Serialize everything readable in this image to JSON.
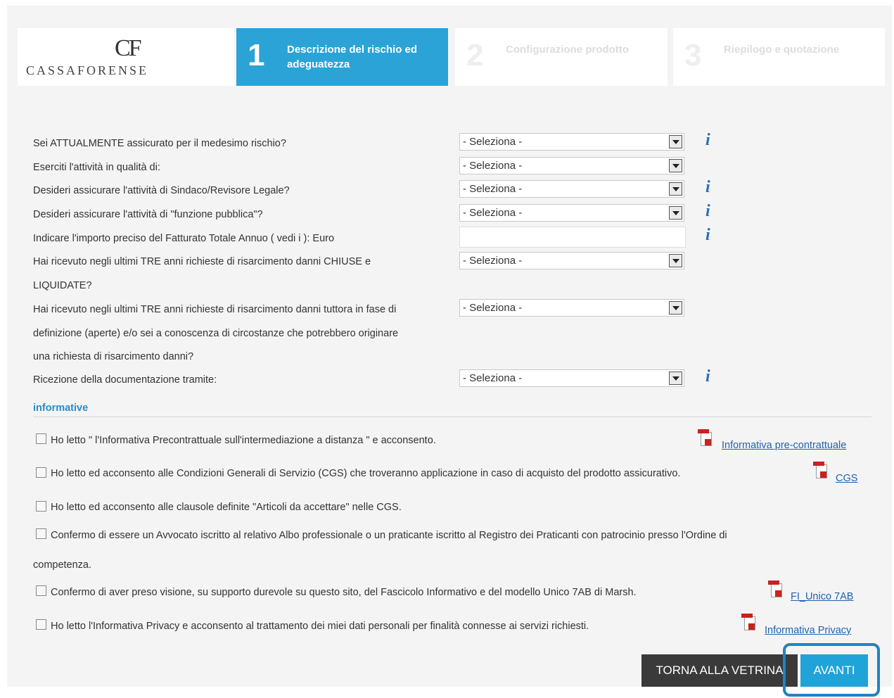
{
  "header": {
    "logo_mark": "CF",
    "logo_text": "CASSAFORENSE",
    "steps": [
      {
        "number": "1",
        "label": "Descrizione del rischio ed adeguatezza",
        "active": true
      },
      {
        "number": "2",
        "label": "Configurazione prodotto",
        "active": false
      },
      {
        "number": "3",
        "label": "Riepilogo e quotazione",
        "active": false
      }
    ]
  },
  "form": {
    "questions": [
      {
        "label": "Sei ATTUALMENTE assicurato per il medesimo rischio?",
        "value": "- Seleziona -",
        "info": true
      },
      {
        "label": "Eserciti l'attività in qualità di:",
        "value": "- Seleziona -",
        "info": false
      },
      {
        "label": "Desideri assicurare l'attività di Sindaco/Revisore Legale?",
        "value": "- Seleziona -",
        "info": true
      },
      {
        "label": "Desideri assicurare l'attività di \"funzione pubblica\"?",
        "value": "- Seleziona -",
        "info": true
      },
      {
        "label": "Indicare l'importo preciso del Fatturato Totale Annuo ( vedi i ): Euro",
        "value": "",
        "info": true
      },
      {
        "label_lines": [
          "Hai ricevuto negli ultimi TRE anni richieste di risarcimento danni CHIUSE e",
          "LIQUIDATE?"
        ],
        "value": "- Seleziona -",
        "info": false
      },
      {
        "label_lines": [
          "Hai ricevuto negli ultimi TRE anni richieste di risarcimento danni tuttora in fase di",
          "definizione (aperte) e/o sei a conoscenza di circostanze che potrebbero originare",
          "una richiesta di risarcimento danni?"
        ],
        "value": "- Seleziona -",
        "info": false
      },
      {
        "label": "Ricezione della documentazione tramite:",
        "value": "- Seleziona -",
        "info": true
      }
    ],
    "info_icon": "i"
  },
  "informative": {
    "title": "informative",
    "items": [
      {
        "text": "Ho letto \" l'Informativa Precontrattuale sull'intermediazione a distanza \" e acconsento.",
        "link": "Informativa pre-contrattuale"
      },
      {
        "text": "Ho letto ed acconsento alle Condizioni Generali di Servizio (CGS) che troveranno applicazione in caso di acquisto del prodotto assicurativo.",
        "link": "CGS"
      },
      {
        "text": "Ho letto ed acconsento alle clausole definite \"Articoli da accettare\" nelle CGS.",
        "link": ""
      },
      {
        "text_lines": [
          "Confermo di essere un Avvocato iscritto al relativo Albo professionale o un praticante iscritto al Registro dei Praticanti con patrocinio presso l'Ordine di",
          "competenza."
        ],
        "link": ""
      },
      {
        "text": "Confermo di aver preso visione, su supporto durevole su questo sito, del Fascicolo Informativo e del modello Unico 7AB di Marsh.",
        "link": "FI_Unico 7AB"
      },
      {
        "text": "Ho letto l'Informativa Privacy e acconsento al trattamento dei miei dati personali per finalità connesse ai servizi richiesti.",
        "link": "Informativa Privacy"
      }
    ]
  },
  "actions": {
    "back_label": "TORNA ALLA VETRINA",
    "next_label": "AVANTI"
  }
}
